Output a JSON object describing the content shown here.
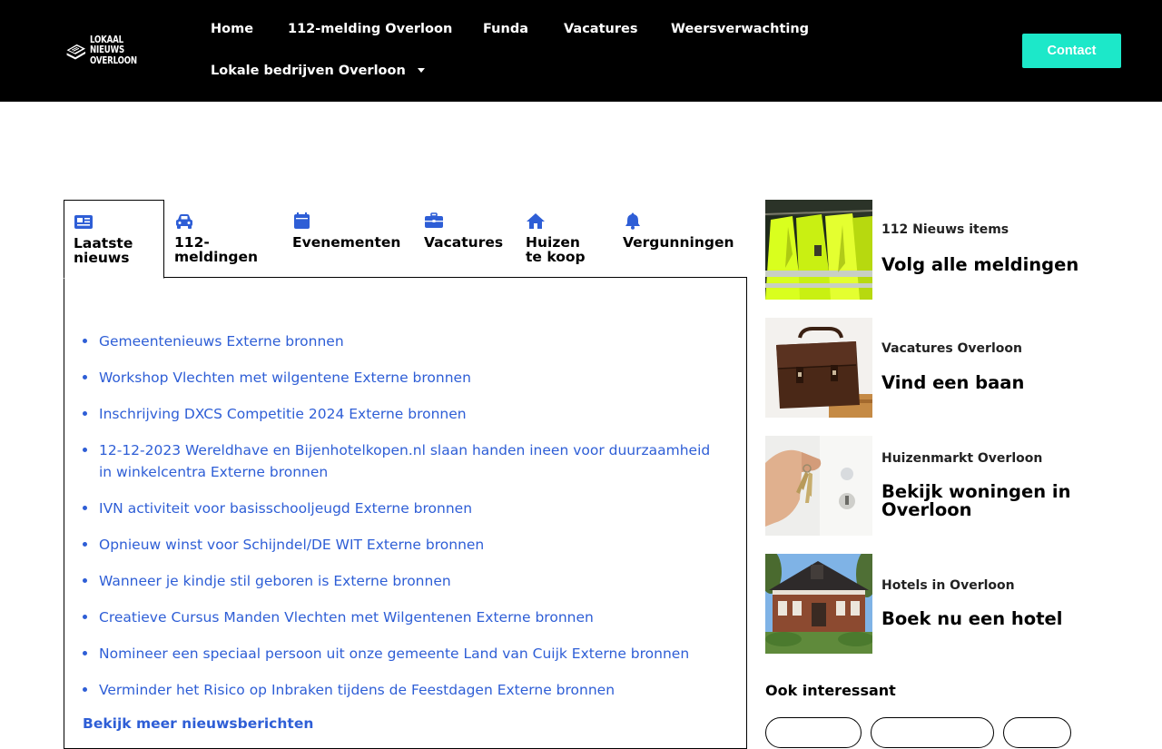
{
  "header": {
    "logo_lines": [
      "LOKAAL",
      "NIEUWS",
      "OVERLOON"
    ],
    "nav": [
      "Home",
      "112-melding Overloon",
      "Funda",
      "Vacatures",
      "Weersverwachting",
      "Lokale bedrijven Overloon"
    ],
    "contact_label": "Contact",
    "accent_color": "#1ce8c9"
  },
  "tabs": [
    {
      "label": "Laatste nieuws",
      "icon": "news-icon"
    },
    {
      "label": "112-meldingen",
      "icon": "car-icon"
    },
    {
      "label": "Evenementen",
      "icon": "calendar-icon"
    },
    {
      "label": "Vacatures",
      "icon": "briefcase-icon"
    },
    {
      "label": "Huizen te koop",
      "icon": "house-icon"
    },
    {
      "label": "Vergunningen",
      "icon": "bell-icon"
    }
  ],
  "news": [
    "Gemeentenieuws Externe bronnen",
    "Workshop Vlechten met wilgentene Externe bronnen",
    "Inschrijving DXCS Competitie 2024 Externe bronnen",
    "12-12-2023 Wereldhave en Bijenhotelkopen.nl slaan handen ineen voor duurzaamheid in winkelcentra Externe bronnen",
    "IVN activiteit voor basisschooljeugd Externe bronnen",
    "Opnieuw winst voor Schijndel/DE WIT Externe bronnen",
    "Wanneer je kindje stil geboren is Externe bronnen",
    "Creatieve Cursus Manden Vlechten met Wilgentenen Externe bronnen",
    "Nomineer een speciaal persoon uit onze gemeente Land van Cuijk Externe bronnen",
    "Verminder het Risico op Inbraken tijdens de Feestdagen Externe bronnen"
  ],
  "more_link": "Bekijk meer nieuwsberichten",
  "sidebar": [
    {
      "kicker": "112 Nieuws items",
      "title": "Volg alle meldingen"
    },
    {
      "kicker": "Vacatures Overloon",
      "title": "Vind een baan"
    },
    {
      "kicker": "Huizenmarkt Overloon",
      "title": "Bekijk woningen in Overloon"
    },
    {
      "kicker": "Hotels in Overloon",
      "title": "Boek nu een hotel"
    }
  ],
  "ook_interessant": "Ook interessant",
  "colors": {
    "link": "#2e5ed6",
    "icon": "#2e5ed6"
  }
}
